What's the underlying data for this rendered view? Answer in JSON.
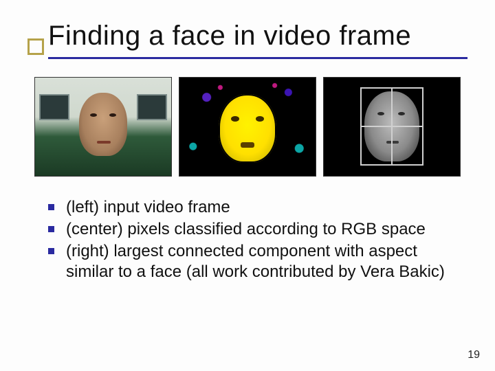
{
  "title": "Finding a face in video frame",
  "images": {
    "left_alt": "input video frame",
    "center_alt": "pixels classified according to RGB space",
    "right_alt": "largest connected component with face aspect"
  },
  "bullets": [
    "(left) input video frame",
    "(center) pixels classified according to RGB space",
    "(right) largest connected component with aspect similar to a face (all work contributed by Vera Bakic)"
  ],
  "page_number": "19"
}
